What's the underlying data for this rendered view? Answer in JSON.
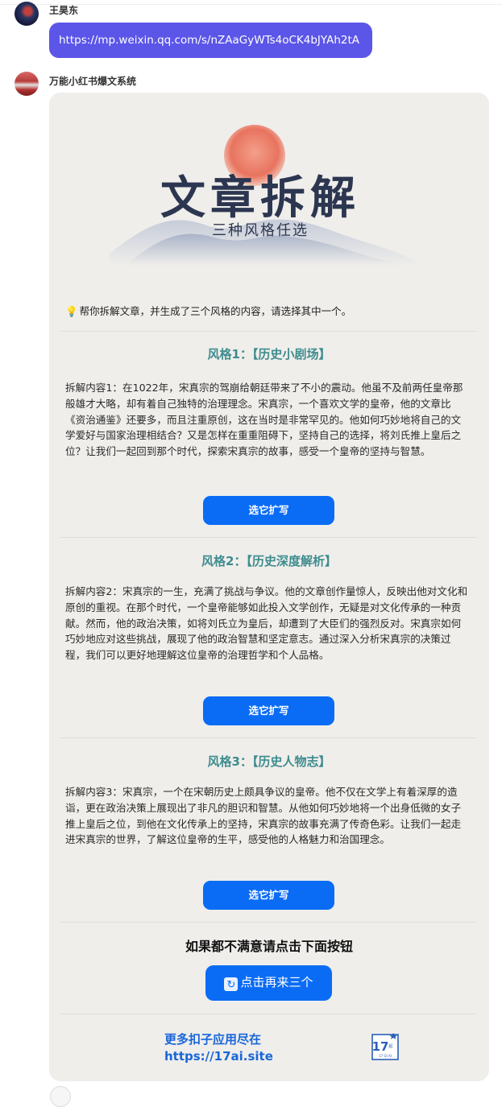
{
  "messages": [
    {
      "sender": "王昊东",
      "link_text": "https://mp.weixin.qq.com/s/nZAaGyWTs4oCK4bJYAh2tA"
    },
    {
      "sender": "万能小红书爆文系统"
    }
  ],
  "banner": {
    "title": "文章拆解",
    "subtitle": "三种风格任选"
  },
  "hint": "帮你拆解文章，并生成了三个风格的内容，请选择其中一个。",
  "styles": [
    {
      "title": "风格1：【历史小剧场】",
      "text": "拆解内容1：在1022年，宋真宗的驾崩给朝廷带来了不小的震动。他虽不及前两任皇帝那般雄才大略，却有着自己独特的治理理念。宋真宗，一个喜欢文学的皇帝，他的文章比《资治通鉴》还要多，而且注重原创，这在当时是非常罕见的。他如何巧妙地将自己的文学爱好与国家治理相结合？又是怎样在重重阻碍下，坚持自己的选择，将刘氏推上皇后之位？让我们一起回到那个时代，探索宋真宗的故事，感受一个皇帝的坚持与智慧。",
      "button": "选它扩写"
    },
    {
      "title": "风格2：【历史深度解析】",
      "text": "拆解内容2：宋真宗的一生，充满了挑战与争议。他的文章创作量惊人，反映出他对文化和原创的重视。在那个时代，一个皇帝能够如此投入文学创作，无疑是对文化传承的一种贡献。然而，他的政治决策，如将刘氏立为皇后，却遭到了大臣们的强烈反对。宋真宗如何巧妙地应对这些挑战，展现了他的政治智慧和坚定意志。通过深入分析宋真宗的决策过程，我们可以更好地理解这位皇帝的治理哲学和个人品格。",
      "button": "选它扩写"
    },
    {
      "title": "风格3：【历史人物志】",
      "text": "拆解内容3：宋真宗，一个在宋朝历史上颇具争议的皇帝。他不仅在文学上有着深厚的造诣，更在政治决策上展现出了非凡的胆识和智慧。从他如何巧妙地将一个出身低微的女子推上皇后之位，到他在文化传承上的坚持，宋真宗的故事充满了传奇色彩。让我们一起走进宋真宗的世界，了解这位皇帝的生平，感受他的人格魅力和治国理念。",
      "button": "选它扩写"
    }
  ],
  "retry": {
    "title": "如果都不满意请点击下面按钮",
    "button": "点击再来三个",
    "icon": "refresh-icon"
  },
  "promo": {
    "line1": "更多扣子应用尽在",
    "line2": "https://17ai.site",
    "logo_text": "17",
    "logo_sub": "起",
    "logo_caption": "17 Qi AI"
  },
  "colors": {
    "link_bubble": "#5b55e8",
    "primary_button": "#0a6cf5",
    "style_title": "#3e8c8e",
    "card_bg": "#efeeeb",
    "promo_text": "#1a66d8"
  }
}
